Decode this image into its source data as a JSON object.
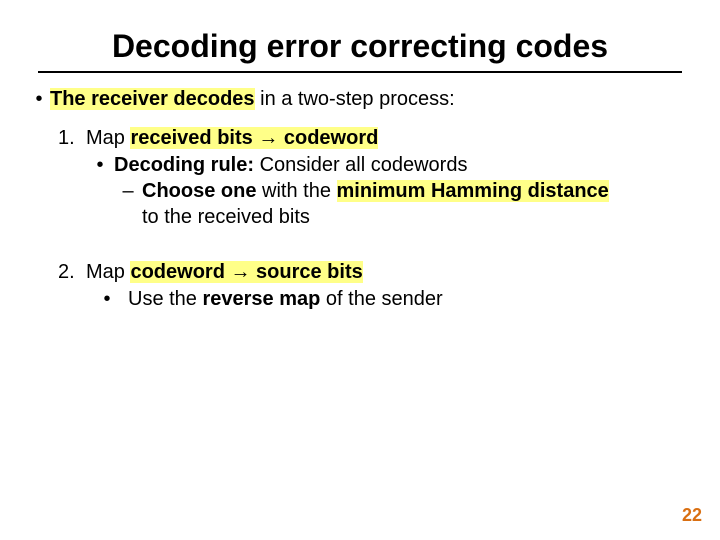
{
  "title": "Decoding error correcting codes",
  "top": {
    "pre": "The receiver decodes",
    "post": " in a two-step process:"
  },
  "step1": {
    "num": "1.",
    "a": "Map ",
    "b": "received bits ",
    "arrow": "→",
    "c": " codeword",
    "rule_label": "Decoding rule:",
    "rule_rest": " Consider all codewords",
    "choose_a": "Choose one",
    "choose_b": " with the ",
    "choose_c": "minimum Hamming distance",
    "choose_tail": "to the received bits"
  },
  "step2": {
    "num": "2.",
    "a": "Map ",
    "b": "codeword ",
    "arrow": "→",
    "c": " source bits",
    "use_a": "Use the ",
    "use_b": "reverse map",
    "use_c": " of the sender"
  },
  "glyphs": {
    "bullet": "•",
    "dash": "–"
  },
  "page": "22"
}
